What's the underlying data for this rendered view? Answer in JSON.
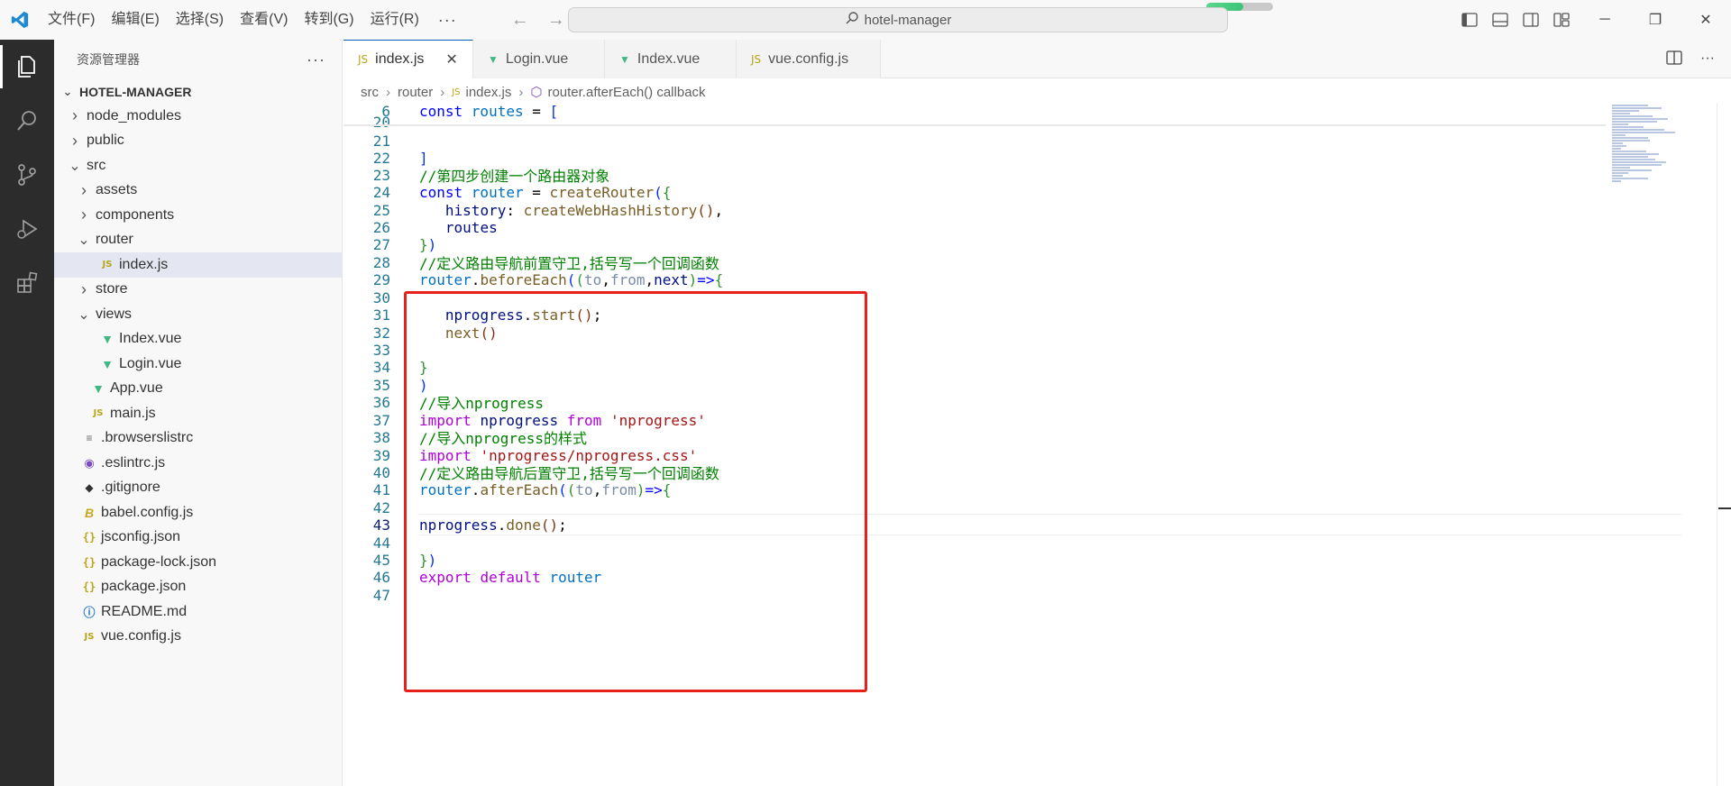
{
  "titlebar": {
    "menu": [
      "文件(F)",
      "编辑(E)",
      "选择(S)",
      "查看(V)",
      "转到(G)",
      "运行(R)"
    ],
    "more": "···",
    "search_text": "hotel-manager",
    "progress_fraction": 0.55
  },
  "activity": [
    "explorer-icon",
    "search-icon",
    "source-control-icon",
    "run-debug-icon",
    "extensions-icon"
  ],
  "sidebar": {
    "title": "资源管理器",
    "more": "···",
    "root": "HOTEL-MANAGER",
    "tree": [
      {
        "label": "node_modules",
        "type": "folder",
        "open": false,
        "depth": 0
      },
      {
        "label": "public",
        "type": "folder",
        "open": false,
        "depth": 0
      },
      {
        "label": "src",
        "type": "folder",
        "open": true,
        "depth": 0
      },
      {
        "label": "assets",
        "type": "folder",
        "open": false,
        "depth": 1
      },
      {
        "label": "components",
        "type": "folder",
        "open": false,
        "depth": 1
      },
      {
        "label": "router",
        "type": "folder",
        "open": true,
        "depth": 1
      },
      {
        "label": "index.js",
        "type": "js",
        "depth": 2,
        "selected": true
      },
      {
        "label": "store",
        "type": "folder",
        "open": false,
        "depth": 1
      },
      {
        "label": "views",
        "type": "folder",
        "open": true,
        "depth": 1
      },
      {
        "label": "Index.vue",
        "type": "vue",
        "depth": 2
      },
      {
        "label": "Login.vue",
        "type": "vue",
        "depth": 2
      },
      {
        "label": "App.vue",
        "type": "vue",
        "depth": 1
      },
      {
        "label": "main.js",
        "type": "js",
        "depth": 1
      },
      {
        "label": ".browserslistrc",
        "type": "cfg",
        "depth": 0
      },
      {
        "label": ".eslintrc.js",
        "type": "eslint",
        "depth": 0
      },
      {
        "label": ".gitignore",
        "type": "git",
        "depth": 0
      },
      {
        "label": "babel.config.js",
        "type": "babel",
        "depth": 0
      },
      {
        "label": "jsconfig.json",
        "type": "json",
        "depth": 0
      },
      {
        "label": "package-lock.json",
        "type": "json",
        "depth": 0
      },
      {
        "label": "package.json",
        "type": "json",
        "depth": 0
      },
      {
        "label": "README.md",
        "type": "info",
        "depth": 0
      },
      {
        "label": "vue.config.js",
        "type": "js",
        "depth": 0
      }
    ]
  },
  "tabs": [
    {
      "label": "index.js",
      "type": "js",
      "active": true
    },
    {
      "label": "Login.vue",
      "type": "vue",
      "active": false
    },
    {
      "label": "Index.vue",
      "type": "vue",
      "active": false
    },
    {
      "label": "vue.config.js",
      "type": "js",
      "active": false
    }
  ],
  "breadcrumb": [
    "src",
    "router",
    "index.js",
    "router.afterEach() callback"
  ],
  "editor": {
    "current_line": "43",
    "lines": [
      {
        "n": "6",
        "tokens": [
          [
            "kw",
            "const "
          ],
          [
            "var",
            "routes"
          ],
          [
            "",
            ""
          ],
          [
            "",
            " = "
          ],
          [
            "br1",
            "["
          ]
        ]
      },
      {
        "n": "20",
        "tokens": []
      },
      {
        "n": "21",
        "tokens": []
      },
      {
        "n": "22",
        "tokens": [
          [
            "br1",
            "]"
          ]
        ]
      },
      {
        "n": "23",
        "tokens": [
          [
            "cmt",
            "//第四步创建一个路由器对象"
          ]
        ]
      },
      {
        "n": "24",
        "tokens": [
          [
            "kw",
            "const "
          ],
          [
            "var",
            "router"
          ],
          [
            "",
            " = "
          ],
          [
            "fn",
            "createRouter"
          ],
          [
            "br1",
            "("
          ],
          [
            "br2",
            "{"
          ]
        ]
      },
      {
        "n": "25",
        "tokens": [
          [
            "",
            " "
          ],
          [
            "id",
            "history"
          ],
          [
            "",
            ": "
          ],
          [
            "fn",
            "createWebHashHistory"
          ],
          [
            "br3",
            "()"
          ],
          [
            "",
            ","
          ]
        ]
      },
      {
        "n": "26",
        "tokens": [
          [
            "",
            " "
          ],
          [
            "id",
            "routes"
          ]
        ]
      },
      {
        "n": "27",
        "tokens": [
          [
            "br2",
            "}"
          ],
          [
            "br1",
            ")"
          ]
        ]
      },
      {
        "n": "28",
        "tokens": [
          [
            "cmt",
            "//定义路由导航前置守卫,括号写一个回调函数"
          ]
        ]
      },
      {
        "n": "29",
        "tokens": [
          [
            "var",
            "router"
          ],
          [
            "",
            "."
          ],
          [
            "fn",
            "beforeEach"
          ],
          [
            "br1",
            "("
          ],
          [
            "br2",
            "("
          ],
          [
            "param",
            "to"
          ],
          [
            "",
            ","
          ],
          [
            "param",
            "from"
          ],
          [
            "",
            ","
          ],
          [
            "id",
            "next"
          ],
          [
            "br2",
            ")"
          ],
          [
            "kw",
            "=>"
          ],
          [
            "br2",
            "{"
          ]
        ]
      },
      {
        "n": "30",
        "tokens": []
      },
      {
        "n": "31",
        "tokens": [
          [
            "",
            " "
          ],
          [
            "id",
            "nprogress"
          ],
          [
            "",
            "."
          ],
          [
            "fn",
            "start"
          ],
          [
            "br3",
            "()"
          ],
          [
            "",
            ";"
          ]
        ]
      },
      {
        "n": "32",
        "tokens": [
          [
            "",
            " "
          ],
          [
            "fn",
            "next"
          ],
          [
            "br3",
            "()"
          ]
        ]
      },
      {
        "n": "33",
        "tokens": []
      },
      {
        "n": "34",
        "tokens": [
          [
            "br2",
            "}"
          ]
        ]
      },
      {
        "n": "35",
        "tokens": [
          [
            "br1",
            ")"
          ]
        ]
      },
      {
        "n": "36",
        "tokens": [
          [
            "cmt",
            "//导入nprogress"
          ]
        ]
      },
      {
        "n": "37",
        "tokens": [
          [
            "ctrl",
            "import "
          ],
          [
            "id",
            "nprogress "
          ],
          [
            "ctrl",
            "from "
          ],
          [
            "str",
            "'nprogress'"
          ]
        ]
      },
      {
        "n": "38",
        "tokens": [
          [
            "cmt",
            "//导入nprogress的样式"
          ]
        ]
      },
      {
        "n": "39",
        "tokens": [
          [
            "ctrl",
            "import "
          ],
          [
            "str",
            "'nprogress/nprogress.css'"
          ]
        ]
      },
      {
        "n": "40",
        "tokens": [
          [
            "cmt",
            "//定义路由导航后置守卫,括号写一个回调函数"
          ]
        ]
      },
      {
        "n": "41",
        "tokens": [
          [
            "var",
            "router"
          ],
          [
            "",
            "."
          ],
          [
            "fn",
            "afterEach"
          ],
          [
            "br1",
            "("
          ],
          [
            "br2",
            "("
          ],
          [
            "param",
            "to"
          ],
          [
            "",
            ","
          ],
          [
            "param",
            "from"
          ],
          [
            "br2",
            ")"
          ],
          [
            "kw",
            "=>"
          ],
          [
            "br2",
            "{"
          ]
        ]
      },
      {
        "n": "42",
        "tokens": []
      },
      {
        "n": "43",
        "tokens": [
          [
            "id",
            "nprogress"
          ],
          [
            "",
            "."
          ],
          [
            "fn",
            "done"
          ],
          [
            "br3",
            "()"
          ],
          [
            "",
            ";"
          ]
        ]
      },
      {
        "n": "44",
        "tokens": []
      },
      {
        "n": "45",
        "tokens": [
          [
            "br2",
            "}"
          ],
          [
            "br1",
            ")"
          ]
        ]
      },
      {
        "n": "46",
        "tokens": [
          [
            "ctrl",
            "export "
          ],
          [
            "ctrl",
            "default "
          ],
          [
            "var",
            "router"
          ]
        ]
      },
      {
        "n": "47",
        "tokens": []
      }
    ]
  },
  "colors": {
    "accent": "#005fb8",
    "highlight_box": "#e8201a",
    "activity_bar": "#2c2c2c"
  }
}
